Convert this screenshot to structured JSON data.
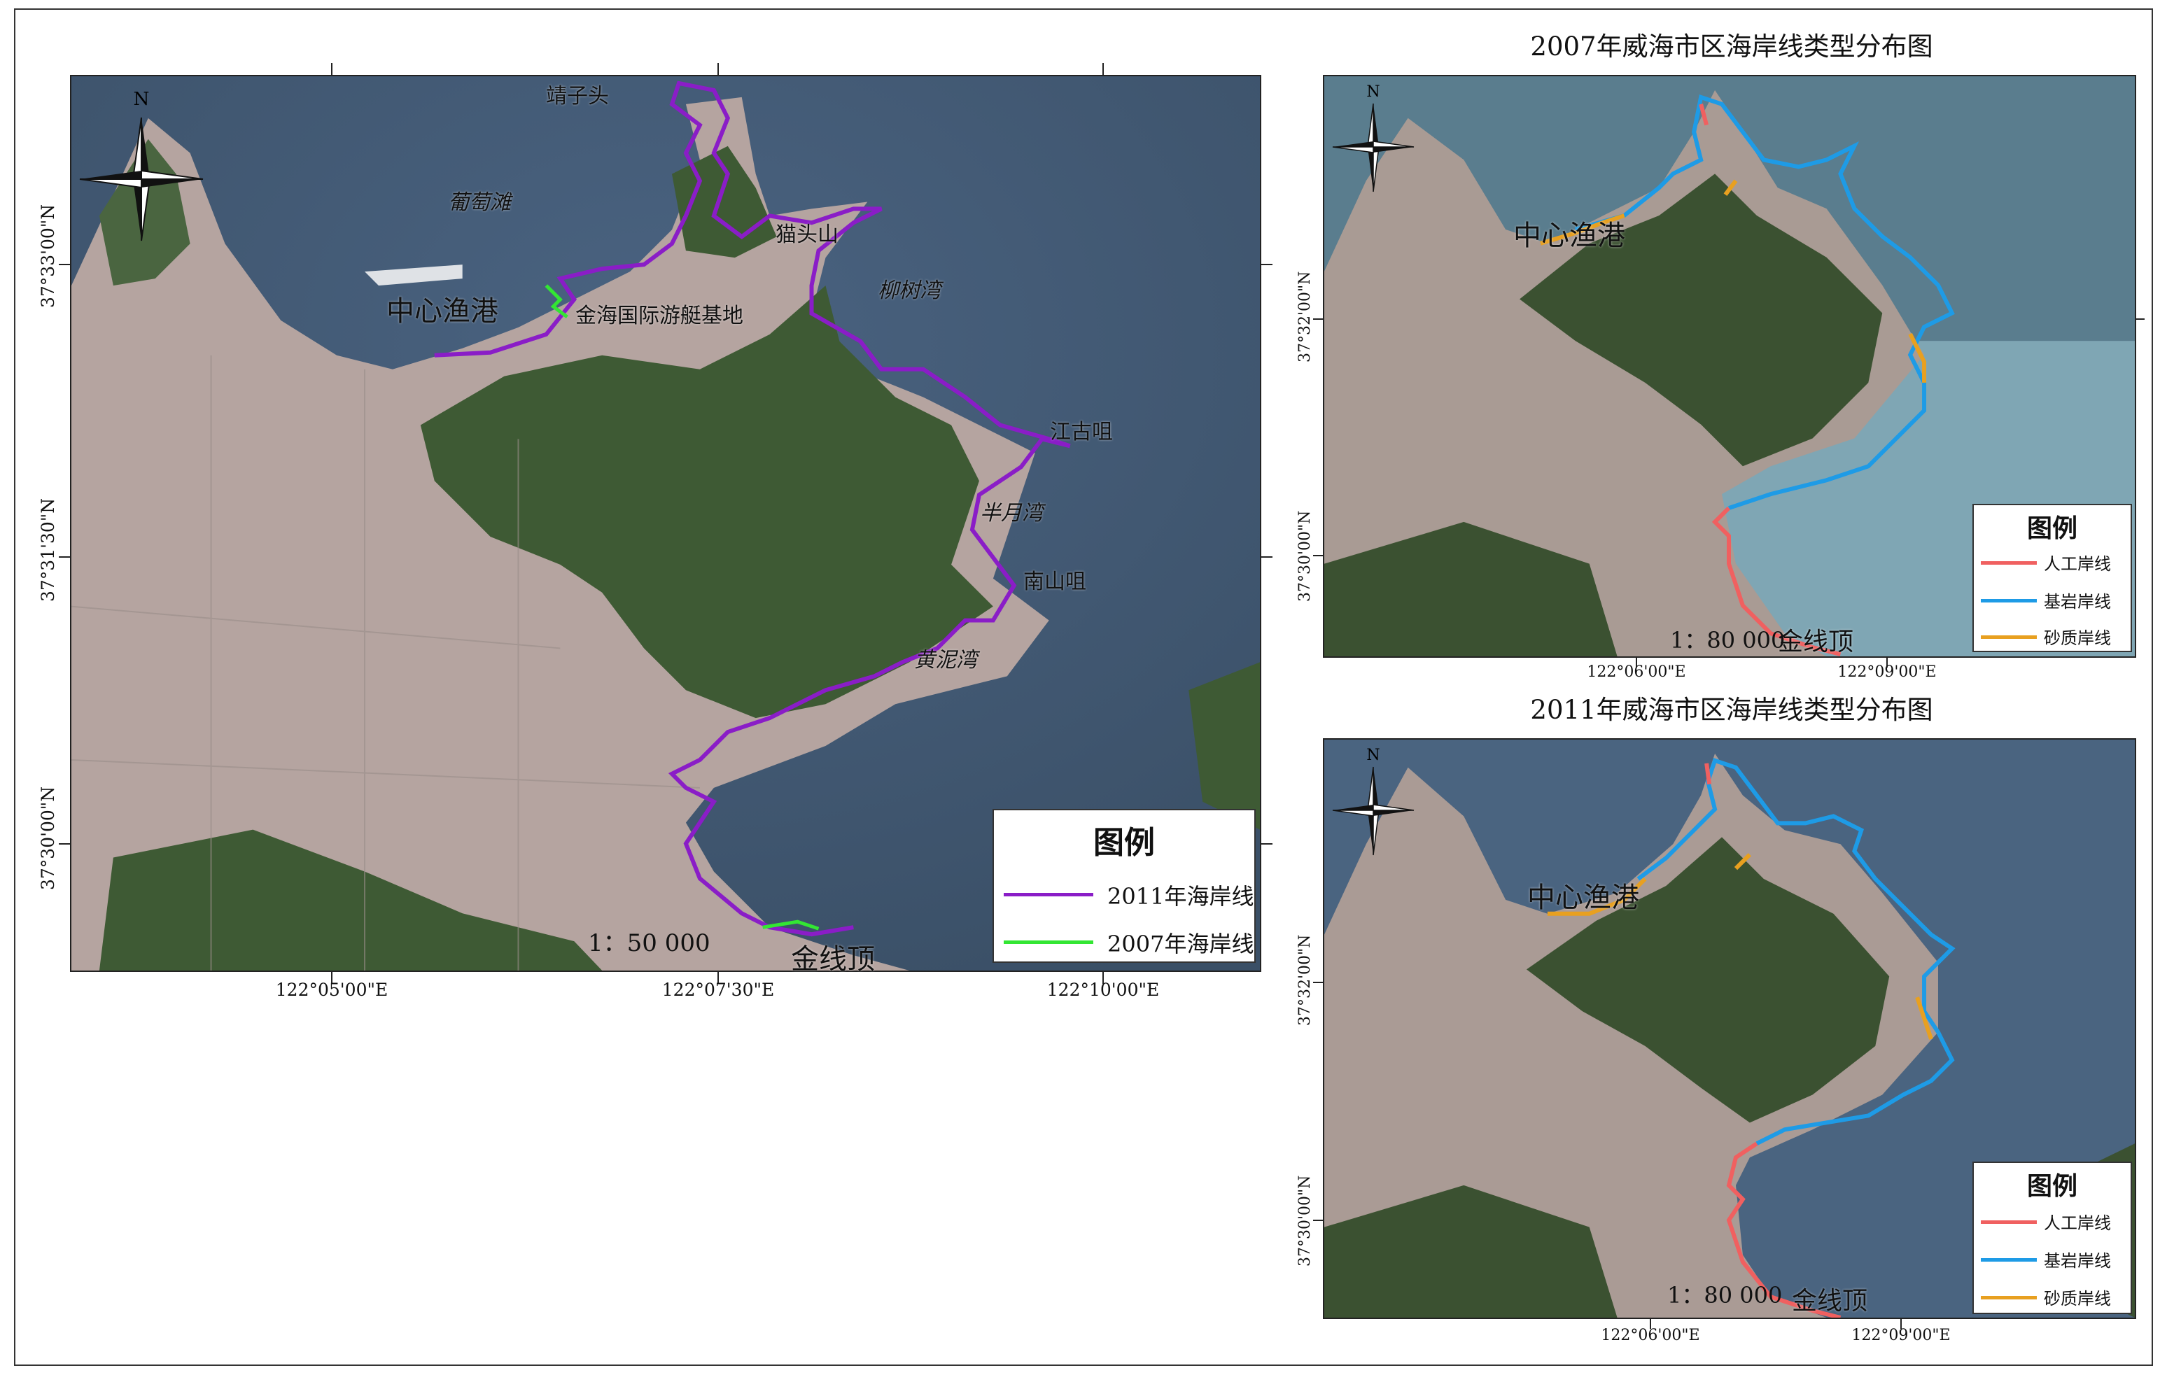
{
  "main_map": {
    "scale": "1：50 000",
    "legend": {
      "title": "图例",
      "items": [
        {
          "label": "2011年海岸线",
          "color": "#8a1dc7"
        },
        {
          "label": "2007年海岸线",
          "color": "#33e633"
        }
      ]
    },
    "labels": {
      "jingzitou": "靖子头",
      "putaotan": "葡萄滩",
      "maotoushan": "猫头山",
      "zhongxin": "中心渔港",
      "jinhai": "金海国际游艇基地",
      "liushuwan": "柳树湾",
      "jianggu": "江古咀",
      "banyue": "半月湾",
      "nanshan": "南山咀",
      "huangni": "黄泥湾",
      "jinxian": "金线顶"
    },
    "x_ticks": [
      "122°05'00\"E",
      "122°07'30\"E",
      "122°10'00\"E"
    ],
    "y_ticks": [
      "37°33'00\"N",
      "37°31'30\"N",
      "37°30'00\"N"
    ],
    "north": "N"
  },
  "map_2007": {
    "title": "2007年威海市区海岸线类型分布图",
    "scale": "1：80 000",
    "labels": {
      "zhongxin": "中心渔港",
      "jinxian": "金线顶"
    },
    "x_ticks": [
      "122°06'00\"E",
      "122°09'00\"E"
    ],
    "y_ticks": [
      "37°32'00\"N",
      "37°30'00\"N"
    ],
    "north": "N",
    "legend": {
      "title": "图例",
      "items": [
        {
          "label": "人工岸线",
          "color": "#f06060"
        },
        {
          "label": "基岩岸线",
          "color": "#1e9be6"
        },
        {
          "label": "砂质岸线",
          "color": "#e8a020"
        }
      ]
    }
  },
  "map_2011": {
    "title": "2011年威海市区海岸线类型分布图",
    "scale": "1：80 000",
    "labels": {
      "zhongxin": "中心渔港",
      "jinxian": "金线顶"
    },
    "x_ticks": [
      "122°06'00\"E",
      "122°09'00\"E"
    ],
    "y_ticks": [
      "37°32'00\"N",
      "37°30'00\"N"
    ],
    "north": "N",
    "legend": {
      "title": "图例",
      "items": [
        {
          "label": "人工岸线",
          "color": "#f06060"
        },
        {
          "label": "基岩岸线",
          "color": "#1e9be6"
        },
        {
          "label": "砂质岸线",
          "color": "#e8a020"
        }
      ]
    }
  },
  "colors": {
    "sea": "#3f5670",
    "land": "#8a8f86",
    "urban": "#b9a7a4",
    "forest": "#3c5a30"
  }
}
